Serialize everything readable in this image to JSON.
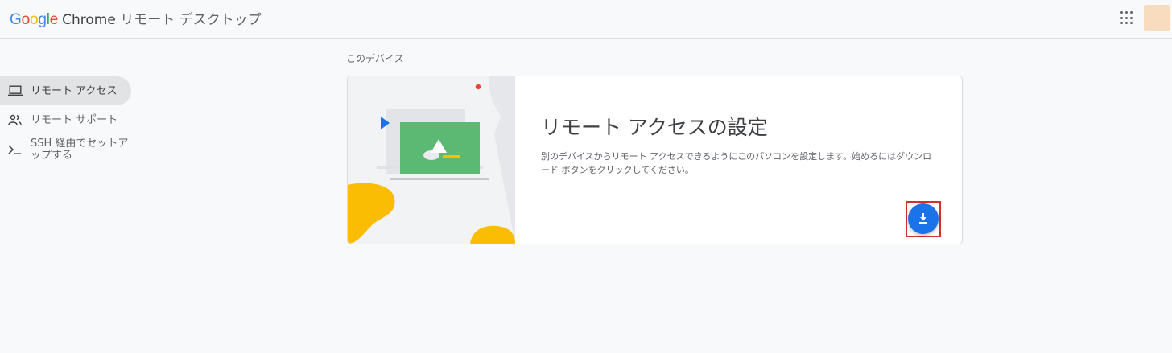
{
  "header": {
    "logo_letters": [
      "G",
      "o",
      "o",
      "g",
      "l",
      "e"
    ],
    "logo_colors": [
      "#4285F4",
      "#EA4335",
      "#FBBC05",
      "#4285F4",
      "#34A853",
      "#EA4335"
    ],
    "product_brand": "Chrome",
    "product_name": "リモート デスクトップ",
    "apps_icon": "apps-grid-icon",
    "avatar_color": "#f8dcbe"
  },
  "sidebar": {
    "items": [
      {
        "label": "リモート アクセス",
        "icon": "laptop-icon",
        "active": true
      },
      {
        "label": "リモート サポート",
        "icon": "people-icon",
        "active": false
      },
      {
        "label": "SSH 経由でセットアップする",
        "label_line1": "SSH 経由でセットア",
        "label_line2": "ップする",
        "icon": "terminal-icon",
        "active": false
      }
    ]
  },
  "main": {
    "section_title": "このデバイス",
    "card": {
      "title": "リモート アクセスの設定",
      "description": "別のデバイスからリモート アクセスできるようにこのパソコンを設定します。始めるにはダウンロード ボタンをクリックしてください。",
      "download_icon": "download-icon"
    }
  },
  "colors": {
    "accent_blue": "#1a73e8",
    "highlight_red": "#d32f2f",
    "illustration_green": "#5bb974",
    "illustration_yellow": "#fbbc04"
  }
}
